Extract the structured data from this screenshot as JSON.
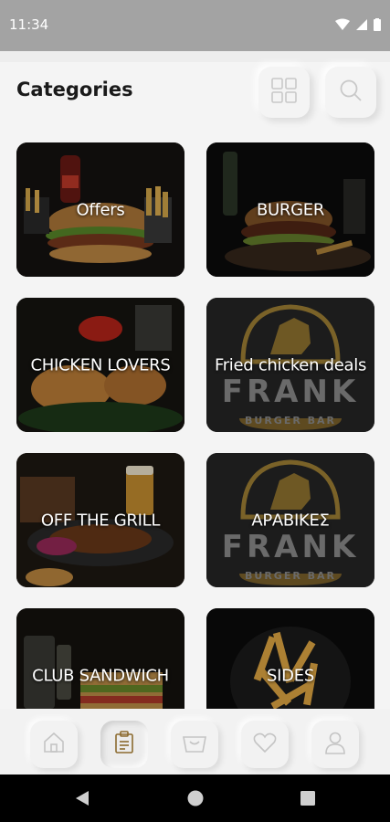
{
  "status_bar": {
    "time": "11:34"
  },
  "header": {
    "title": "Categories"
  },
  "categories": [
    {
      "label": "Offers",
      "theme": "burger"
    },
    {
      "label": "BURGER",
      "theme": "burger-dark"
    },
    {
      "label": "CHICKEN LOVERS",
      "theme": "chicken"
    },
    {
      "label": "Fried chicken deals",
      "theme": "frank"
    },
    {
      "label": "OFF THE GRILL",
      "theme": "grill"
    },
    {
      "label": "ΑΡΑΒΙΚΕΣ",
      "theme": "frank"
    },
    {
      "label": "CLUB SANDWICH",
      "theme": "sandwich"
    },
    {
      "label": "SIDES",
      "theme": "fries"
    }
  ],
  "frank_logo": {
    "brand": "FRANK",
    "sub": "BURGER BAR"
  },
  "bottom_nav": [
    "home-icon",
    "menu-icon",
    "basket-icon",
    "heart-icon",
    "user-icon"
  ],
  "colors": {
    "accent": "#8b6a2e",
    "background": "#f4f4f4",
    "status_bar": "#a3a3a3"
  }
}
